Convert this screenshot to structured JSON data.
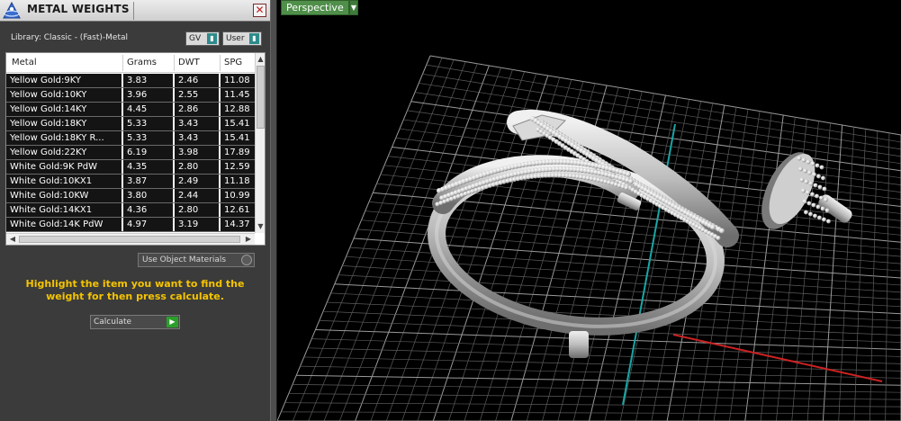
{
  "window": {
    "title": "METAL WEIGHTS",
    "close_glyph": "✕"
  },
  "library": {
    "label": "Library: Classic - (Fast)-Metal",
    "unit_select": "GV",
    "source_select": "User"
  },
  "table": {
    "columns": [
      "Metal",
      "Grams",
      "DWT",
      "SPG"
    ],
    "rows": [
      {
        "metal": "Yellow Gold:9KY",
        "grams": "3.83",
        "dwt": "2.46",
        "spg": "11.08"
      },
      {
        "metal": "Yellow Gold:10KY",
        "grams": "3.96",
        "dwt": "2.55",
        "spg": "11.45"
      },
      {
        "metal": "Yellow Gold:14KY",
        "grams": "4.45",
        "dwt": "2.86",
        "spg": "12.88"
      },
      {
        "metal": "Yellow Gold:18KY",
        "grams": "5.33",
        "dwt": "3.43",
        "spg": "15.41"
      },
      {
        "metal": "Yellow Gold:18KY R...",
        "grams": "5.33",
        "dwt": "3.43",
        "spg": "15.41"
      },
      {
        "metal": "Yellow Gold:22KY",
        "grams": "6.19",
        "dwt": "3.98",
        "spg": "17.89"
      },
      {
        "metal": "White Gold:9K PdW",
        "grams": "4.35",
        "dwt": "2.80",
        "spg": "12.59"
      },
      {
        "metal": "White Gold:10KX1",
        "grams": "3.87",
        "dwt": "2.49",
        "spg": "11.18"
      },
      {
        "metal": "White Gold:10KW",
        "grams": "3.80",
        "dwt": "2.44",
        "spg": "10.99"
      },
      {
        "metal": "White Gold:14KX1",
        "grams": "4.36",
        "dwt": "2.80",
        "spg": "12.61"
      },
      {
        "metal": "White Gold:14K PdW",
        "grams": "4.97",
        "dwt": "3.19",
        "spg": "14.37"
      }
    ]
  },
  "options": {
    "use_object_materials": "Use Object Materials"
  },
  "instructions": "Highlight the item you want to find the weight for then press calculate.",
  "calculate_label": "Calculate",
  "viewport": {
    "view_name": "Perspective"
  },
  "colors": {
    "accent_teal": "#2f8b8b",
    "instruction_yellow": "#f5c400",
    "viewport_tab": "#4f8f4a",
    "axis_red": "#cc2222",
    "axis_teal": "#1aa6a6"
  }
}
